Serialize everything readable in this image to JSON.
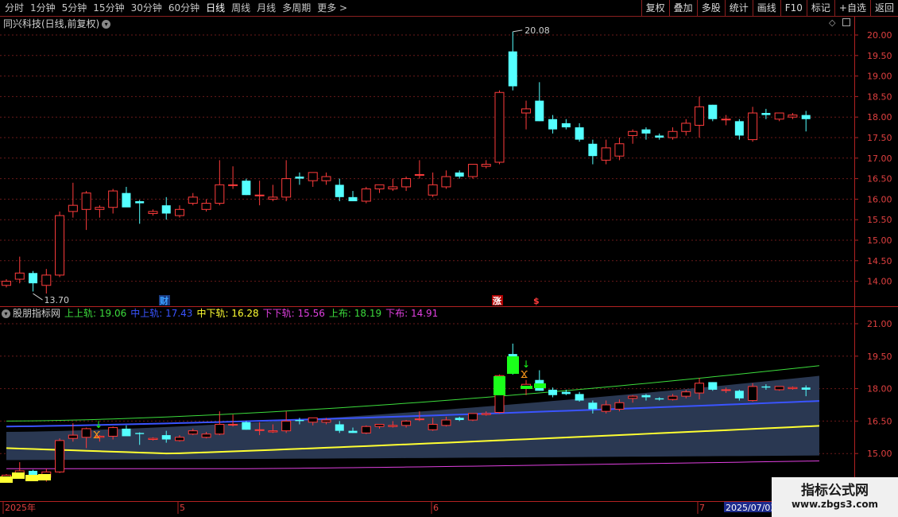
{
  "toolbar": {
    "periods": [
      "分时",
      "1分钟",
      "5分钟",
      "15分钟",
      "30分钟",
      "60分钟",
      "日线",
      "周线",
      "月线",
      "多周期",
      "更多"
    ],
    "active_period": "日线",
    "more_arrow": ">",
    "right_buttons": [
      "复权",
      "叠加",
      "多股",
      "统计",
      "画线",
      "F10",
      "标记",
      "+自选",
      "返回"
    ]
  },
  "main_panel": {
    "title": "同兴科技(日线,前复权)",
    "high_label": "20.08",
    "low_label": "13.70",
    "price_axis": [
      "20.00",
      "19.50",
      "19.00",
      "18.50",
      "18.00",
      "17.50",
      "17.00",
      "16.50",
      "16.00",
      "15.50",
      "15.00",
      "14.50",
      "14.00"
    ],
    "markers": [
      "财",
      "涨",
      "$"
    ],
    "icons": [
      "dropdown-icon",
      "diamond-icon",
      "layout-icon"
    ]
  },
  "indicator_panel": {
    "name": "股朋指标网",
    "legend": [
      {
        "label": "上上轨:",
        "value": "19.06",
        "color": "#3cdc3c"
      },
      {
        "label": "中上轨:",
        "value": "17.43",
        "color": "#3a54ff"
      },
      {
        "label": "中下轨:",
        "value": "16.28",
        "color": "#ffff32"
      },
      {
        "label": "下下轨:",
        "value": "15.56",
        "color": "#e040e0"
      },
      {
        "label": "上布:",
        "value": "18.19",
        "color": "#3cdc3c"
      },
      {
        "label": "下布:",
        "value": "14.91",
        "color": "#e040e0"
      }
    ],
    "value_axis": [
      "21.00",
      "19.50",
      "18.00",
      "16.50",
      "15.00"
    ]
  },
  "date_axis": {
    "labels": [
      "2025年",
      "5",
      "6",
      "7"
    ],
    "cursor_date": "2025/07/03"
  },
  "watermark": {
    "title": "指标公式网",
    "url": "www.zbgs3.com"
  },
  "colors": {
    "up": "#ff3c3c",
    "down": "#54ffff",
    "axis_red": "#b22222",
    "band_fill": "#2a3852"
  },
  "chart_data": {
    "type": "candlestick",
    "candles_ohlc": [
      [
        13.9,
        14.05,
        13.85,
        14.0
      ],
      [
        14.05,
        14.6,
        13.95,
        14.2
      ],
      [
        14.2,
        14.25,
        13.75,
        13.95
      ],
      [
        13.9,
        14.3,
        13.7,
        14.15
      ],
      [
        14.15,
        15.7,
        14.1,
        15.6
      ],
      [
        15.7,
        16.4,
        15.55,
        15.85
      ],
      [
        15.75,
        16.2,
        15.25,
        16.15
      ],
      [
        15.75,
        15.85,
        15.55,
        15.8
      ],
      [
        15.8,
        16.25,
        15.65,
        16.2
      ],
      [
        16.15,
        16.3,
        15.85,
        15.8
      ],
      [
        15.95,
        15.98,
        15.4,
        15.9
      ],
      [
        15.65,
        15.75,
        15.6,
        15.7
      ],
      [
        15.85,
        16.05,
        15.5,
        15.65
      ],
      [
        15.6,
        15.85,
        15.55,
        15.75
      ],
      [
        15.9,
        16.15,
        15.85,
        16.05
      ],
      [
        15.75,
        16.0,
        15.7,
        15.9
      ],
      [
        15.9,
        16.95,
        15.85,
        16.35
      ],
      [
        16.35,
        16.8,
        16.25,
        16.35
      ],
      [
        16.45,
        16.5,
        16.1,
        16.1
      ],
      [
        16.1,
        16.45,
        15.85,
        16.1
      ],
      [
        16.0,
        16.35,
        15.95,
        16.05
      ],
      [
        16.05,
        16.95,
        15.95,
        16.5
      ],
      [
        16.55,
        16.65,
        16.35,
        16.5
      ],
      [
        16.45,
        16.65,
        16.3,
        16.65
      ],
      [
        16.45,
        16.65,
        16.35,
        16.55
      ],
      [
        16.35,
        16.5,
        15.95,
        16.05
      ],
      [
        16.05,
        16.2,
        15.95,
        15.95
      ],
      [
        15.95,
        16.3,
        15.9,
        16.25
      ],
      [
        16.25,
        16.35,
        16.15,
        16.35
      ],
      [
        16.25,
        16.5,
        16.2,
        16.3
      ],
      [
        16.3,
        16.55,
        16.2,
        16.5
      ],
      [
        16.6,
        16.95,
        16.5,
        16.6
      ],
      [
        16.1,
        16.65,
        16.05,
        16.35
      ],
      [
        16.3,
        16.7,
        16.25,
        16.55
      ],
      [
        16.65,
        16.7,
        16.5,
        16.55
      ],
      [
        16.55,
        16.85,
        16.5,
        16.85
      ],
      [
        16.8,
        16.95,
        16.75,
        16.85
      ],
      [
        16.9,
        18.65,
        16.85,
        18.6
      ],
      [
        19.6,
        20.08,
        18.65,
        18.75
      ],
      [
        18.1,
        18.4,
        17.7,
        18.2
      ],
      [
        18.4,
        18.85,
        17.9,
        17.9
      ],
      [
        17.95,
        18.05,
        17.6,
        17.7
      ],
      [
        17.85,
        17.95,
        17.7,
        17.75
      ],
      [
        17.75,
        17.85,
        17.4,
        17.45
      ],
      [
        17.35,
        17.45,
        16.85,
        17.05
      ],
      [
        16.95,
        17.45,
        16.85,
        17.25
      ],
      [
        17.05,
        17.5,
        16.95,
        17.35
      ],
      [
        17.55,
        17.7,
        17.35,
        17.65
      ],
      [
        17.7,
        17.75,
        17.45,
        17.6
      ],
      [
        17.55,
        17.6,
        17.45,
        17.5
      ],
      [
        17.5,
        17.75,
        17.45,
        17.65
      ],
      [
        17.65,
        17.95,
        17.55,
        17.85
      ],
      [
        17.8,
        18.5,
        17.5,
        18.25
      ],
      [
        18.3,
        18.3,
        17.9,
        17.95
      ],
      [
        17.95,
        18.05,
        17.8,
        17.95
      ],
      [
        17.9,
        17.95,
        17.45,
        17.55
      ],
      [
        17.45,
        18.25,
        17.4,
        18.1
      ],
      [
        18.1,
        18.2,
        17.95,
        18.05
      ],
      [
        17.95,
        18.1,
        17.9,
        18.1
      ],
      [
        18.0,
        18.1,
        17.95,
        18.05
      ],
      [
        18.05,
        18.15,
        17.65,
        17.95
      ]
    ],
    "bands": {
      "upper_upper_last": 19.06,
      "mid_upper_last": 17.43,
      "mid_lower_last": 16.28,
      "lower_lower_last": 15.56,
      "upper_boll_last": 18.19,
      "lower_boll_last": 14.91
    },
    "price_range": [
      13.7,
      20.08
    ]
  }
}
